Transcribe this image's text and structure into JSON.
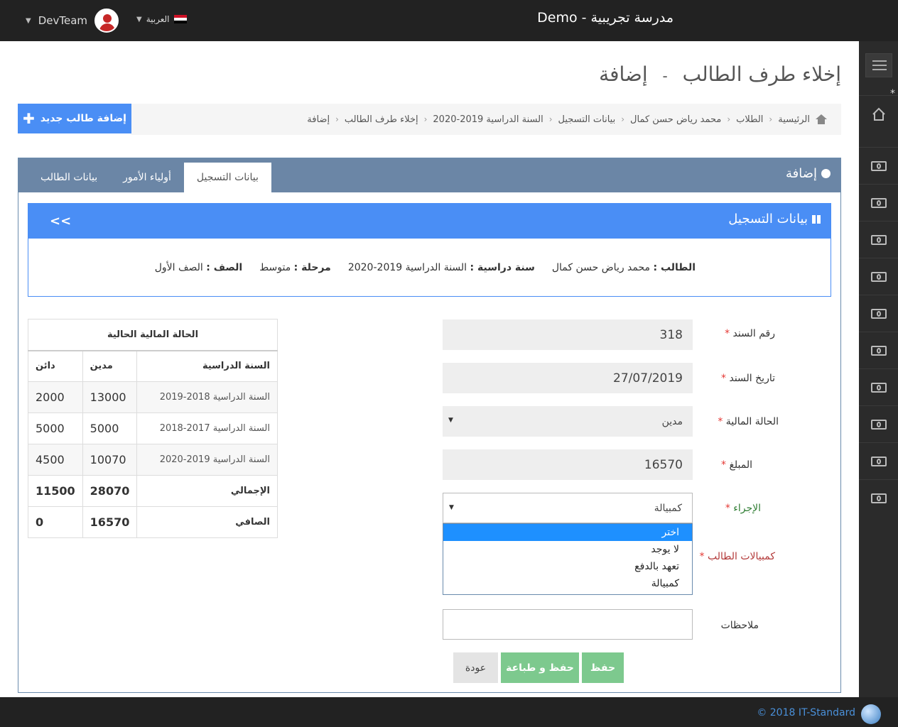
{
  "header": {
    "title": "مدرسة تجريبية - Demo",
    "user_name": "DevTeam",
    "language": "العربية"
  },
  "footer": {
    "copyright": "© 2018 IT-Standard"
  },
  "page": {
    "title_main": "إخلاء طرف الطالب",
    "title_sep": "-",
    "title_sub": "إضافة"
  },
  "breadcrumb": [
    "الرئيسية",
    "الطلاب",
    "محمد رياض حسن كمال",
    "بيانات التسجيل",
    "السنة الدراسية 2019-2020",
    "إخلاء طرف الطالب",
    "إضافة"
  ],
  "add_student_button": "إضافة طالب جديد",
  "portlet": {
    "title": "إضافة",
    "tabs": [
      {
        "label": "بيانات التسجيل",
        "active": true
      },
      {
        "label": "أولياء الأمور",
        "active": false
      },
      {
        "label": "بيانات الطالب",
        "active": false
      }
    ]
  },
  "registration": {
    "title": "بيانات التسجيل",
    "collapse": "<<",
    "student_label": "الطالب :",
    "student_value": "محمد رياض حسن كمال",
    "year_label": "سنة دراسية :",
    "year_value": "السنة الدراسية 2019-2020",
    "stage_label": "مرحلة :",
    "stage_value": "متوسط",
    "class_label": "الصف :",
    "class_value": "الصف الأول"
  },
  "form": {
    "receipt_no_label": "رقم السند",
    "receipt_no_value": "318",
    "receipt_date_label": "تاريخ السند",
    "receipt_date_value": "27/07/2019",
    "fin_status_label": "الحالة المالية",
    "fin_status_value": "مدين",
    "amount_label": "المبلغ",
    "amount_value": "16570",
    "action_label": "الإجراء",
    "action_value": "كمبيالة",
    "action_options": [
      "اختر",
      "لا يوجد",
      "تعهد بالدفع",
      "كمبيالة"
    ],
    "bills_label": "كمبيالات الطالب",
    "notes_label": "ملاحظات",
    "notes_value": "",
    "required_mark": "*"
  },
  "buttons": {
    "save": "حفظ",
    "save_print": "حفظ و طباعة",
    "back": "عودة"
  },
  "finance_table": {
    "caption": "الحالة المالية الحالية",
    "headers": [
      "السنة الدراسية",
      "مدين",
      "دائن"
    ],
    "rows": [
      [
        "السنة الدراسية 2018-2019",
        "13000",
        "2000"
      ],
      [
        "السنة الدراسية 2017-2018",
        "5000",
        "5000"
      ],
      [
        "السنة الدراسية 2019-2020",
        "10070",
        "4500"
      ]
    ],
    "total": [
      "الإجمالي",
      "28070",
      "11500"
    ],
    "net": [
      "الصافي",
      "16570",
      "0"
    ]
  },
  "colors": {
    "primary": "#4a8ef5",
    "portlet": "#6b86a6",
    "success": "#7dc98e",
    "required": "#e53935"
  },
  "sidebar": {
    "items": [
      "home-icon",
      "money-icon",
      "money-icon",
      "money-icon",
      "money-icon",
      "money-icon",
      "money-icon",
      "money-icon",
      "money-icon",
      "money-icon",
      "money-icon",
      "money-icon"
    ]
  }
}
